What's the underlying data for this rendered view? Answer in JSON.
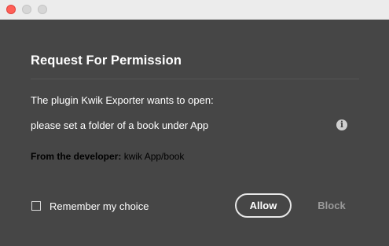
{
  "window": {
    "controls": [
      "close",
      "minimize",
      "maximize"
    ]
  },
  "dialog": {
    "title": "Request For Permission",
    "message": "The plugin Kwik Exporter wants to open:",
    "request": "please set a folder of a book under App",
    "info_icon": "info-icon",
    "developer_label": "From the developer:",
    "developer_value": "kwik App/book",
    "remember_label": "Remember my choice",
    "remember_checked": false,
    "allow_label": "Allow",
    "block_label": "Block"
  },
  "colors": {
    "background": "#464646",
    "text": "#ffffff",
    "disabled": "#9a9a9a",
    "close_button": "#ff5f57"
  }
}
